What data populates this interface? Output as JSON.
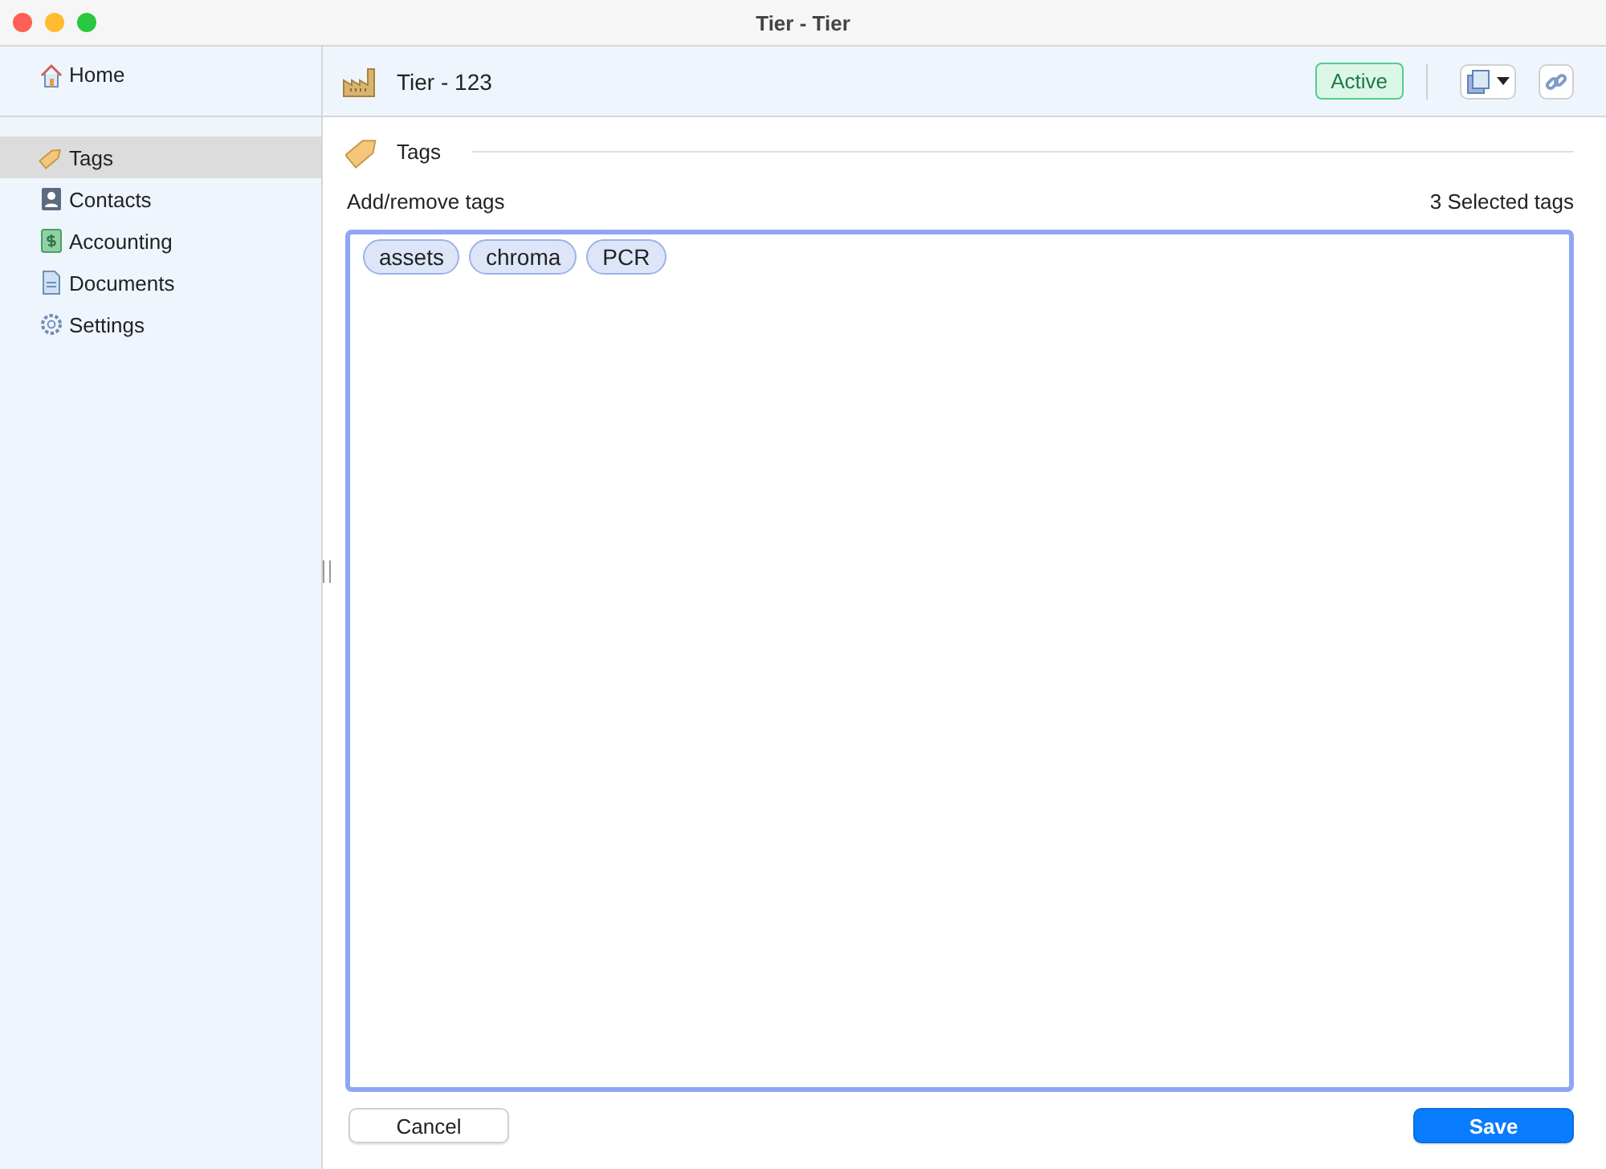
{
  "window": {
    "title": "Tier - Tier"
  },
  "sidebar": {
    "home": {
      "label": "Home"
    },
    "items": [
      {
        "label": "Tags",
        "kind": "tag",
        "selected": true
      },
      {
        "label": "Contacts",
        "kind": "contact",
        "selected": false
      },
      {
        "label": "Accounting",
        "kind": "accounting",
        "selected": false
      },
      {
        "label": "Documents",
        "kind": "document",
        "selected": false
      },
      {
        "label": "Settings",
        "kind": "gear",
        "selected": false
      }
    ]
  },
  "header": {
    "title": "Tier - 123",
    "status": "Active"
  },
  "section": {
    "title": "Tags",
    "label": "Add/remove tags",
    "count": "3 Selected tags",
    "tags": [
      "assets",
      "chroma",
      "PCR"
    ]
  },
  "buttons": {
    "cancel": "Cancel",
    "save": "Save"
  }
}
